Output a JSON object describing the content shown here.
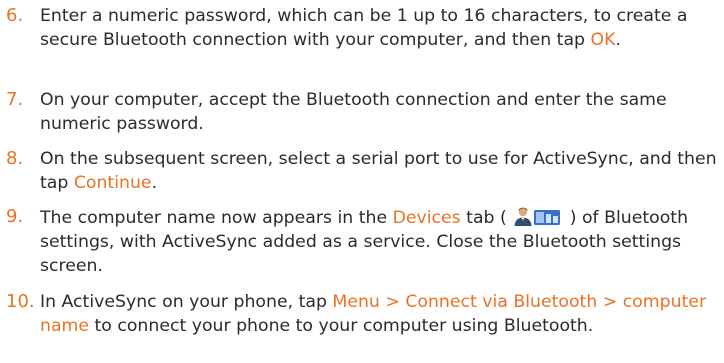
{
  "colors": {
    "accent": "#e97224",
    "text": "#2b2b2b"
  },
  "steps": {
    "s6": {
      "num": "6.",
      "a": "Enter a numeric password, which can be 1 up to 16 characters, to create a secure Bluetooth connection with your computer, and then tap ",
      "b": "OK",
      "c": "."
    },
    "s7": {
      "num": "7.",
      "a": "On your computer, accept the Bluetooth connection and enter the same numeric password."
    },
    "s8": {
      "num": "8.",
      "a": "On the subsequent screen, select a serial port to use for ActiveSync, and then tap ",
      "b": "Continue",
      "c": "."
    },
    "s9": {
      "num": "9.",
      "a": "The computer name now appears in the ",
      "b": "Devices",
      "c": " tab ( ",
      "d": " ) of Bluetooth settings, with ActiveSync added as a service. Close the Bluetooth settings screen.",
      "icon": "devices-tab-icon"
    },
    "s10": {
      "num": "10.",
      "a": "In ActiveSync on your phone, tap ",
      "b": "Menu > Connect via Bluetooth > computer name",
      "c": " to connect your phone to your computer using Bluetooth."
    }
  }
}
